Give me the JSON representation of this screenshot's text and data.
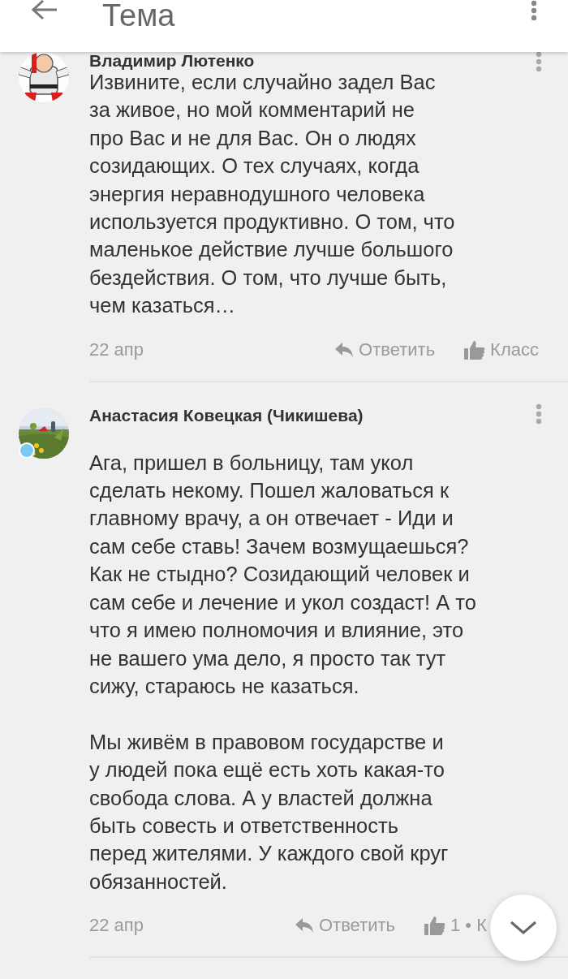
{
  "header": {
    "title": "Тема"
  },
  "comments": [
    {
      "author": "Владимир Лютенко",
      "online": false,
      "text": "Извините, если случайно задел Вас\nза живое, но мой комментарий не\nпро Вас и не для Вас. Он о людях\nсозидающих. О тех случаях, когда\nэнергия неравнодушного человека\nиспользуется продуктивно. О том, что\nмаленькое действие лучше большого\nбездействия. О том, что лучше быть,\nчем казаться…",
      "date": "22 апр",
      "reply": "Ответить",
      "like": "Класс"
    },
    {
      "author": "Анастасия Ковецкая (Чикишева)",
      "online": true,
      "text": "Ага, пришел в больницу, там укол\nсделать некому. Пошел жаловаться к\nглавному врачу, а он отвечает - Иди и\nсам себе ставь! Зачем возмущаешься?\nКак не стыдно? Созидающий человек и\nсам себе и лечение и укол создаст! А то\nчто я имею полномочия и влияние, это\nне вашего ума дело, я просто так тут\nсижу, стараюсь не казаться.\n\nМы живём в правовом государстве и\nу людей пока ещё есть хоть какая-то\nсвобода слова. А у властей должна\nбыть совесть и ответственность\nперед жителями. У каждого свой круг\nобязанностей.",
      "date": "22 апр",
      "reply": "Ответить",
      "like": "1 • К"
    }
  ]
}
